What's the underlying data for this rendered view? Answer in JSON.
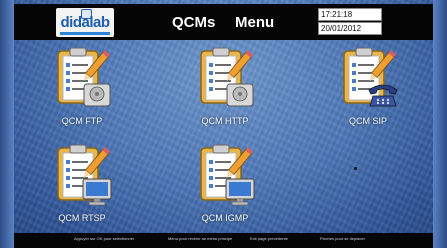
{
  "header": {
    "logo_text": "didalab",
    "title_left": "QCMs",
    "title_right": "Menu",
    "time": "17:21:18",
    "date": "20/01/2012"
  },
  "tiles": [
    {
      "label": "QCM FTP",
      "device": "hard-drive-icon"
    },
    {
      "label": "QCM HTTP",
      "device": "hard-drive-icon"
    },
    {
      "label": "QCM SIP",
      "device": "telephone-icon"
    },
    {
      "label": "QCM RTSP",
      "device": "monitor-icon"
    },
    {
      "label": "QCM IGMP",
      "device": "monitor-icon"
    }
  ],
  "footer": {
    "hint_ok": "Appuyer sur OK pour selectionner",
    "hint_menu": "Menu pour revenir au menu principe",
    "hint_exit": "Exit page precedente",
    "hint_arrows": "Fleches pour se deplacer"
  },
  "colors": {
    "background": "#4d78b8",
    "bars": "#050505",
    "logo": "#1e5fb0"
  }
}
